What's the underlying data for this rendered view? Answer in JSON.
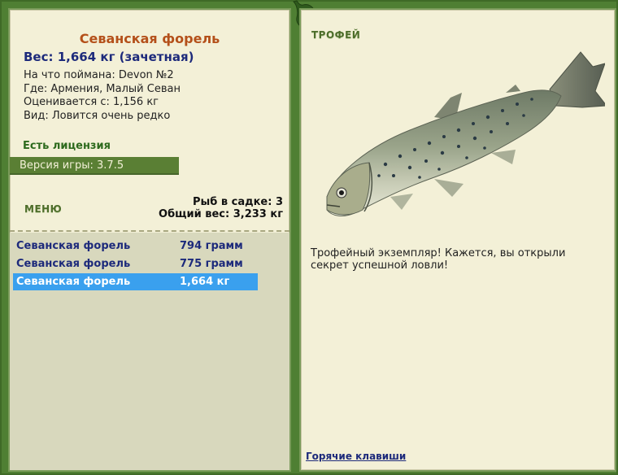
{
  "fish": {
    "name": "Севанская форель",
    "weight_line": "Вес: 1,664 кг (зачетная)",
    "details": [
      "На что поймана: Devon №2",
      "Где: Армения, Малый Севан",
      "Оценивается с: 1,156 кг",
      "Вид: Ловится очень редко"
    ]
  },
  "license": "Есть лицензия",
  "version": "Версия игры: 3.7.5",
  "menu_label": "МЕНЮ",
  "keeper": {
    "count_line": "Рыб в садке: 3",
    "total_line": "Общий вес: 3,233 кг"
  },
  "catch_list": [
    {
      "name": "Севанская форель",
      "weight": "794 грамм",
      "selected": false
    },
    {
      "name": "Севанская форель",
      "weight": "775 грамм",
      "selected": false
    },
    {
      "name": "Севанская форель",
      "weight": "1,664 кг",
      "selected": true
    }
  ],
  "trophy": {
    "title": "ТРОФЕЙ",
    "text": "Трофейный экземпляр! Кажется, вы открыли секрет успешной ловли!",
    "image_icon": "trout-image"
  },
  "hotkeys": "Горячие клавиши",
  "colors": {
    "frame_green": "#4f7f33",
    "panel_bg": "#f3f0d7",
    "name_orange": "#b4501a",
    "navy_text": "#1d2a7b",
    "selected_row": "#3aa0ee"
  }
}
